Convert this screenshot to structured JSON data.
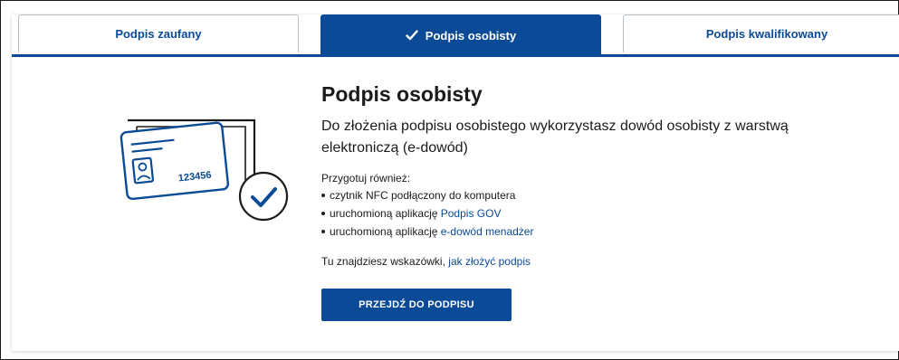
{
  "tabs": [
    {
      "label": "Podpis zaufany",
      "selected": false
    },
    {
      "label": "Podpis osobisty",
      "selected": true
    },
    {
      "label": "Podpis kwalifikowany",
      "selected": false
    }
  ],
  "main": {
    "title": "Podpis osobisty",
    "lead": "Do złożenia podpisu osobistego wykorzystasz dowód osobisty z warstwą elektroniczą (e-dowód)",
    "prepare_label": "Przygotuj również:",
    "requirements": [
      {
        "text": "czytnik NFC podłączony do komputera",
        "link": ""
      },
      {
        "text": "uruchomioną aplikację ",
        "link": "Podpis GOV"
      },
      {
        "text": "uruchomioną aplikację ",
        "link": "e-dowód menadżer"
      }
    ],
    "hint_text": "Tu znajdziesz wskazówki, ",
    "hint_link": "jak złożyć podpis",
    "cta_label": "PRZEJDŹ DO PODPISU"
  },
  "illustration": {
    "card_number": "123456"
  },
  "colors": {
    "accent": "#0b4a96",
    "text": "#1b1b1b",
    "tab_border": "#b7bfc8"
  }
}
